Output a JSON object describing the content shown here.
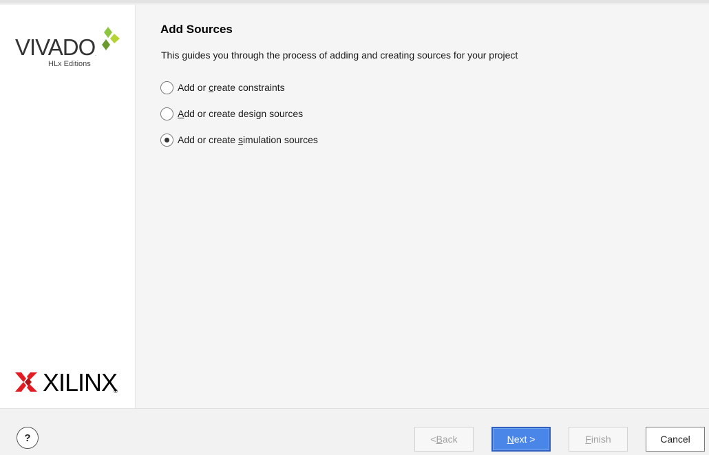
{
  "sidebar": {
    "vivado_logo": {
      "word": "VIVADO",
      "sub": "HLx Editions",
      "dot": "."
    },
    "xilinx_logo": {
      "word": "XILINX",
      "registered": "®"
    }
  },
  "main": {
    "title": "Add Sources",
    "description": "This guides you through the process of adding and creating sources for your project",
    "options": [
      {
        "pre": "Add or ",
        "mnemonic": "c",
        "post": "reate constraints",
        "selected": false
      },
      {
        "pre": "",
        "mnemonic": "A",
        "post": "dd or create design sources",
        "selected": false
      },
      {
        "pre": "Add or create ",
        "mnemonic": "s",
        "post": "imulation sources",
        "selected": true
      }
    ]
  },
  "footer": {
    "help_label": "?",
    "back": {
      "pre": "< ",
      "mnemonic": "B",
      "post": "ack",
      "enabled": false
    },
    "next": {
      "pre": "",
      "mnemonic": "N",
      "post": "ext >",
      "enabled": true
    },
    "finish": {
      "pre": "",
      "mnemonic": "F",
      "post": "inish",
      "enabled": false
    },
    "cancel": {
      "label": "Cancel",
      "enabled": true
    }
  },
  "colors": {
    "primary_button": "#4a86e8",
    "xilinx_red": "#e31c23",
    "vivado_green": "#8cc63f"
  },
  "icons": [
    "vivado-logo-mark",
    "xilinx-logo-mark",
    "help-icon"
  ]
}
